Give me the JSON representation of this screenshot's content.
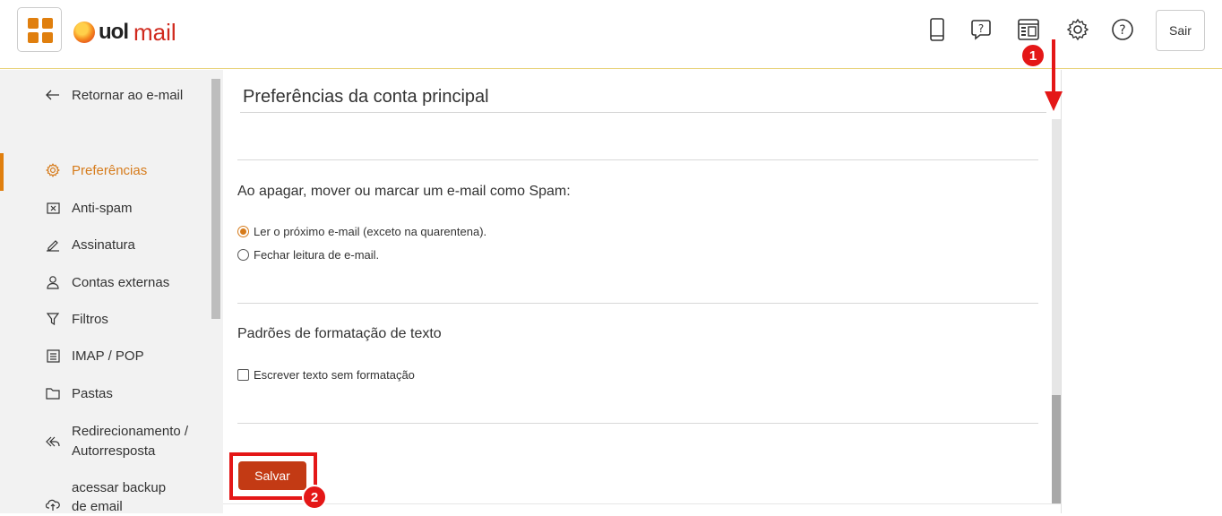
{
  "header": {
    "brand_uol": "uol",
    "brand_mail": "mail",
    "icons": [
      "mobile-icon",
      "help-chat-icon",
      "layout-icon",
      "gear-icon",
      "question-icon"
    ],
    "sair_label": "Sair"
  },
  "sidebar": {
    "back_label": "Retornar ao e-mail",
    "items": [
      {
        "label": "Preferências",
        "icon": "gear-icon",
        "active": true
      },
      {
        "label": "Anti-spam",
        "icon": "spam-box-icon"
      },
      {
        "label": "Assinatura",
        "icon": "signature-pen-icon"
      },
      {
        "label": "Contas externas",
        "icon": "user-icon"
      },
      {
        "label": "Filtros",
        "icon": "filter-icon"
      },
      {
        "label": "IMAP / POP",
        "icon": "imap-icon"
      },
      {
        "label": "Pastas",
        "icon": "folder-icon"
      },
      {
        "label_line1": "Redirecionamento /",
        "label_line2": "Autorresposta",
        "icon": "reply-all-icon"
      },
      {
        "label_line1": "acessar backup",
        "label_line2": "de email",
        "icon": "cloud-icon"
      }
    ]
  },
  "main": {
    "title": "Preferências da conta principal",
    "spam_section": {
      "title": "Ao apagar, mover ou marcar um e-mail como Spam:",
      "options": [
        {
          "label": "Ler o próximo e-mail (exceto na quarentena).",
          "selected": true
        },
        {
          "label": "Fechar leitura de e-mail.",
          "selected": false
        }
      ]
    },
    "format_section": {
      "title": "Padrões de formatação de texto",
      "checkbox_label": "Escrever texto sem formatação",
      "checked": false
    },
    "save_label": "Salvar"
  },
  "annotations": {
    "badge1": "1",
    "badge2": "2",
    "color": "#e41717"
  },
  "colors": {
    "accent": "#e07f0e",
    "save_button": "#c33a14",
    "brand_red": "#d02a1e"
  }
}
